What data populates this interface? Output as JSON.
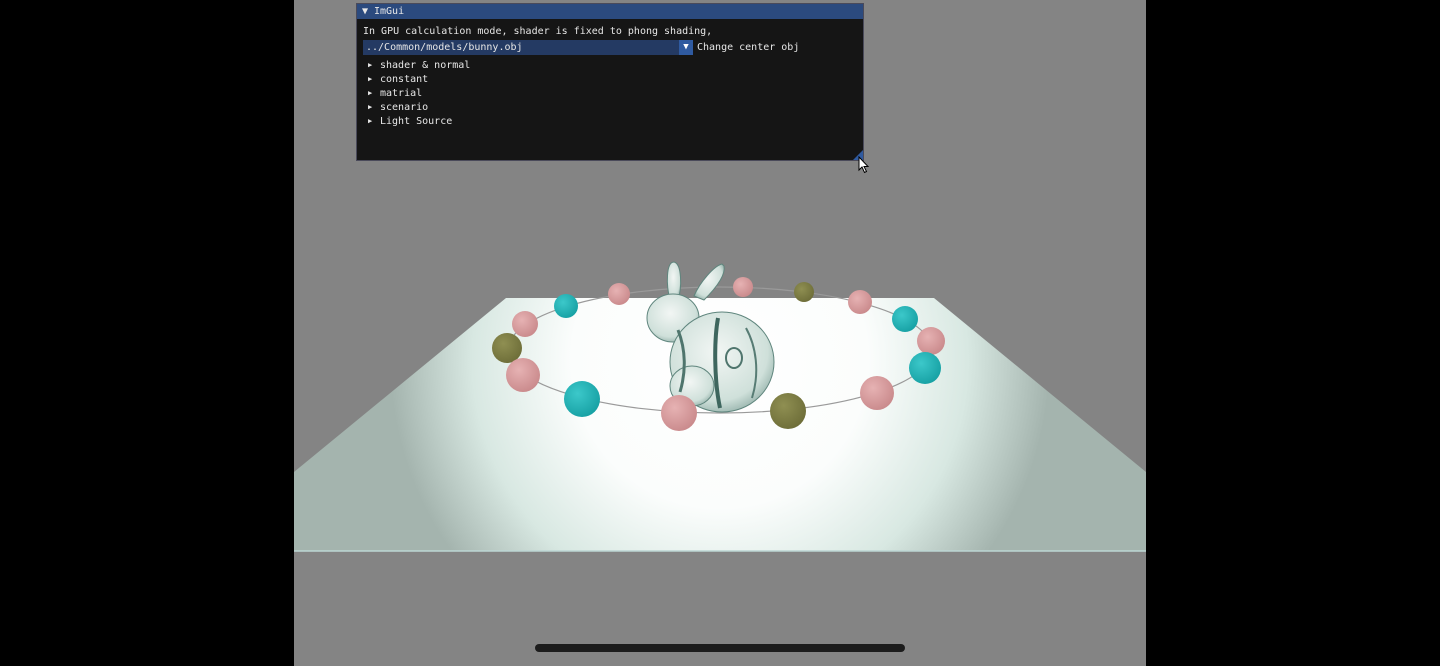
{
  "window": {
    "title": "ImGui",
    "info_text": "In GPU calculation mode, shader is fixed to phong shading,",
    "model_combo": {
      "value": "../Common/models/bunny.obj",
      "label": "Change center obj"
    },
    "tree_nodes": [
      {
        "label": "shader & normal"
      },
      {
        "label": "constant"
      },
      {
        "label": "matrial"
      },
      {
        "label": "scenario"
      },
      {
        "label": "Light Source"
      }
    ]
  },
  "colors": {
    "background": "#848484",
    "titlebar": "#2b4a7e",
    "window_bg": "#151515",
    "sphere_pink": "#d79a9c",
    "sphere_teal": "#1db5b7",
    "sphere_olive": "#7c7c44"
  },
  "icons": {
    "collapse": "triangle-down-icon",
    "tree_node": "triangle-right-icon",
    "combo": "combo-arrow-icon",
    "cursor": "mouse-pointer-icon"
  }
}
